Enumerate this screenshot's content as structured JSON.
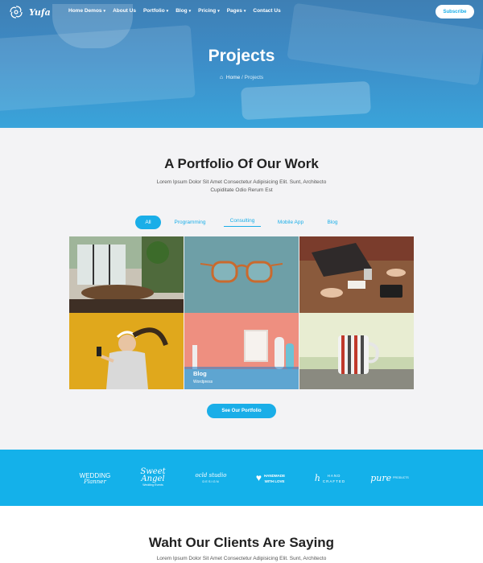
{
  "brand": {
    "name": "Yufa"
  },
  "nav": {
    "items": [
      {
        "label": "Home Demos",
        "dropdown": true
      },
      {
        "label": "About Us",
        "dropdown": false
      },
      {
        "label": "Portfolio",
        "dropdown": true
      },
      {
        "label": "Blog",
        "dropdown": true
      },
      {
        "label": "Pricing",
        "dropdown": true
      },
      {
        "label": "Pages",
        "dropdown": true
      },
      {
        "label": "Contact Us",
        "dropdown": false
      }
    ],
    "subscribe_label": "Subscribe"
  },
  "hero": {
    "title": "Projects",
    "breadcrumb": {
      "home": "Home",
      "separator": "/",
      "current": "Projects"
    }
  },
  "portfolio": {
    "title": "A Portfolio Of Our Work",
    "description": "Lorem Ipsum Dolor Sit Amet Consectetur Adipisicing Elit. Sunt, Architecto Cupiditate Odio Rerum Est",
    "filters": [
      "All",
      "Programming",
      "Consulting",
      "Mobile App",
      "Blog"
    ],
    "active_filter": "All",
    "items": [
      {
        "image": "cafe-interior"
      },
      {
        "image": "orange-glasses"
      },
      {
        "image": "meeting-table"
      },
      {
        "image": "woman-headphones"
      },
      {
        "image": "pink-desk",
        "caption_title": "Blog",
        "caption_sub": "Wordpress"
      },
      {
        "image": "striped-mug"
      }
    ],
    "see_button": "See Our Portfolio"
  },
  "brands": [
    {
      "main": "WEDDING",
      "sub": "Planner"
    },
    {
      "main": "Sweet Angel",
      "sub": "Wedding Events"
    },
    {
      "main": "ocld studio",
      "sub": "DESIGN"
    },
    {
      "main": "HANDMADE",
      "sub": "WITH LOVE"
    },
    {
      "main": "HAND",
      "sub": "CRAFTED"
    },
    {
      "main": "pure",
      "sub": "PRODUCTS"
    }
  ],
  "clients": {
    "title": "Waht Our Clients Are Saying",
    "description": "Lorem Ipsum Dolor Sit Amet Consectetur Adipisicing Elit. Sunt, Architecto"
  },
  "colors": {
    "accent": "#1aaee8",
    "brand_band": "#14b1ea",
    "section_bg": "#f3f3f5"
  }
}
